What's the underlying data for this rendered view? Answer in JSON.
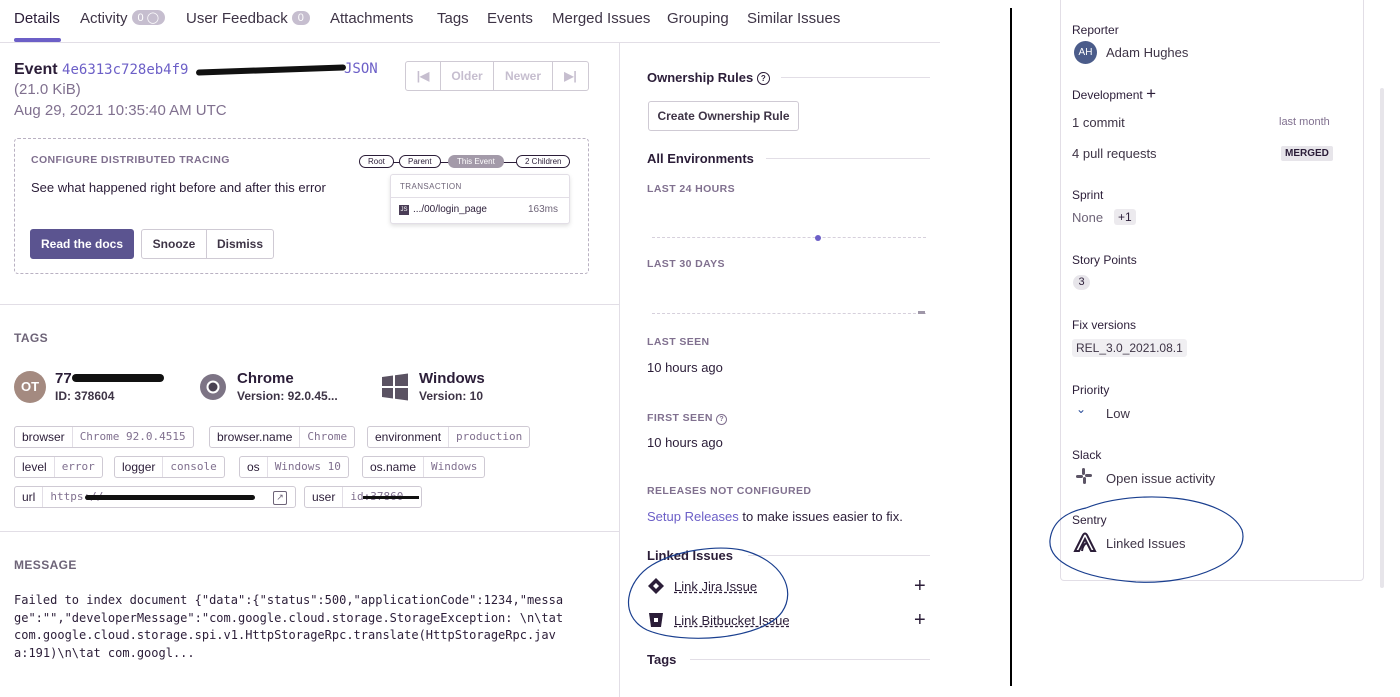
{
  "tabs": [
    {
      "label": "Details"
    },
    {
      "label": "Activity",
      "badge": "0"
    },
    {
      "label": "User Feedback",
      "badge": "0"
    },
    {
      "label": "Attachments"
    },
    {
      "label": "Tags"
    },
    {
      "label": "Events"
    },
    {
      "label": "Merged Issues"
    },
    {
      "label": "Grouping"
    },
    {
      "label": "Similar Issues"
    }
  ],
  "event": {
    "prefix": "Event",
    "id": "4e6313c728eb4f9",
    "json_link": "JSON",
    "size": "(21.0 KiB)",
    "timestamp": "Aug 29, 2021 10:35:40 AM UTC"
  },
  "pager": {
    "older": "Older",
    "newer": "Newer"
  },
  "tracing": {
    "title": "CONFIGURE DISTRIBUTED TRACING",
    "description": "See what happened right before and after this error",
    "read_docs": "Read the docs",
    "snooze": "Snooze",
    "dismiss": "Dismiss",
    "chips": [
      "Root",
      "Parent",
      "This Event",
      "2 Children"
    ],
    "transaction_label": "TRANSACTION",
    "transaction_name": ".../00/login_page",
    "transaction_duration": "163ms",
    "transaction_icon_text": "JS"
  },
  "tags_section": {
    "title": "TAGS",
    "user": {
      "initials": "OT",
      "name": "77",
      "id": "ID: 378604"
    },
    "browser": {
      "name": "Chrome",
      "version": "Version: 92.0.45..."
    },
    "os": {
      "name": "Windows",
      "version": "Version: 10"
    },
    "pills": [
      {
        "key": "browser",
        "value": "Chrome 92.0.4515"
      },
      {
        "key": "browser.name",
        "value": "Chrome"
      },
      {
        "key": "environment",
        "value": "production"
      },
      {
        "key": "level",
        "value": "error"
      },
      {
        "key": "logger",
        "value": "console"
      },
      {
        "key": "os",
        "value": "Windows 10"
      },
      {
        "key": "os.name",
        "value": "Windows"
      },
      {
        "key": "url",
        "value": "https://"
      },
      {
        "key": "user",
        "value": "id:37860"
      }
    ]
  },
  "message": {
    "title": "MESSAGE",
    "lines": [
      "Failed to index document {\"data\":{\"status\":500,\"applicationCode\":1234,\"messa",
      "ge\":\"\",\"developerMessage\":\"com.google.cloud.storage.StorageException: \\n\\tat",
      "com.google.cloud.storage.spi.v1.HttpStorageRpc.translate(HttpStorageRpc.jav",
      "a:191)\\n\\tat com.googl..."
    ]
  },
  "sidebar": {
    "ownership_title": "Ownership Rules",
    "create_rule": "Create Ownership Rule",
    "all_env": "All Environments",
    "last24": "LAST 24 HOURS",
    "last30": "LAST 30 DAYS",
    "last_seen_label": "LAST SEEN",
    "last_seen": "10 hours ago",
    "first_seen_label": "FIRST SEEN",
    "first_seen": "10 hours ago",
    "releases_label": "RELEASES NOT CONFIGURED",
    "setup_releases": "Setup Releases",
    "releases_suffix": "to make issues easier to fix.",
    "linked_title": "Linked Issues",
    "link_jira": "Link Jira Issue",
    "link_bitbucket": "Link Bitbucket Issue",
    "tags_title": "Tags"
  },
  "jira": {
    "reporter_label": "Reporter",
    "reporter_initials": "AH",
    "reporter_name": "Adam Hughes",
    "development_label": "Development",
    "commit": "1 commit",
    "commit_time": "last month",
    "pull_requests": "4 pull requests",
    "merged": "MERGED",
    "sprint_label": "Sprint",
    "sprint_value": "None",
    "sprint_extra": "+1",
    "story_points_label": "Story Points",
    "story_points": "3",
    "fix_versions_label": "Fix versions",
    "fix_version": "REL_3.0_2021.08.1",
    "priority_label": "Priority",
    "priority": "Low",
    "slack_label": "Slack",
    "slack_link": "Open issue activity",
    "sentry_label": "Sentry",
    "sentry_link": "Linked Issues"
  },
  "colors": {
    "accent": "#6c5fc7",
    "annotation": "#1a3f8f",
    "divider": "#000000"
  }
}
